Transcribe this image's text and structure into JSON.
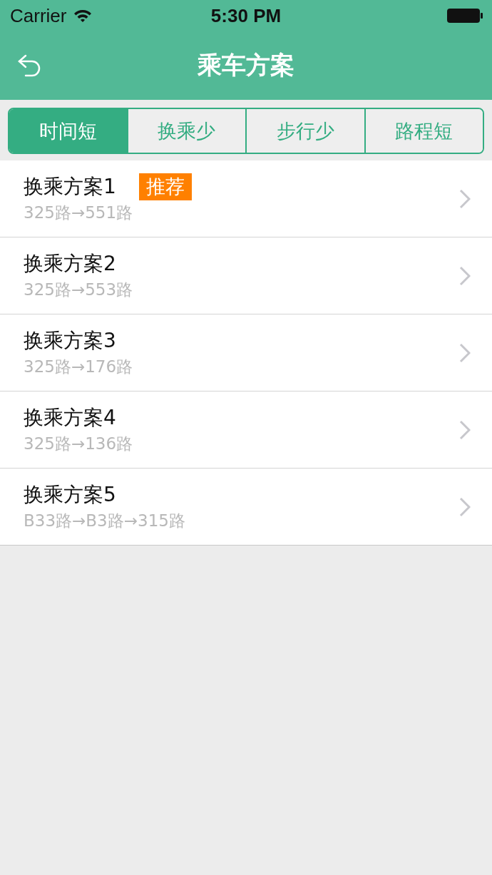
{
  "status_bar": {
    "carrier": "Carrier",
    "time": "5:30 PM"
  },
  "nav_bar": {
    "title": "乘车方案"
  },
  "tabs": [
    {
      "label": "时间短",
      "selected": true
    },
    {
      "label": "换乘少",
      "selected": false
    },
    {
      "label": "步行少",
      "selected": false
    },
    {
      "label": "路程短",
      "selected": false
    }
  ],
  "plans": [
    {
      "title": "换乘方案1",
      "badge": "推荐",
      "route": "325路→551路"
    },
    {
      "title": "换乘方案2",
      "route": "325路→553路"
    },
    {
      "title": "换乘方案3",
      "route": "325路→176路"
    },
    {
      "title": "换乘方案4",
      "route": "325路→136路"
    },
    {
      "title": "换乘方案5",
      "route": "B33路→B3路→315路"
    }
  ]
}
